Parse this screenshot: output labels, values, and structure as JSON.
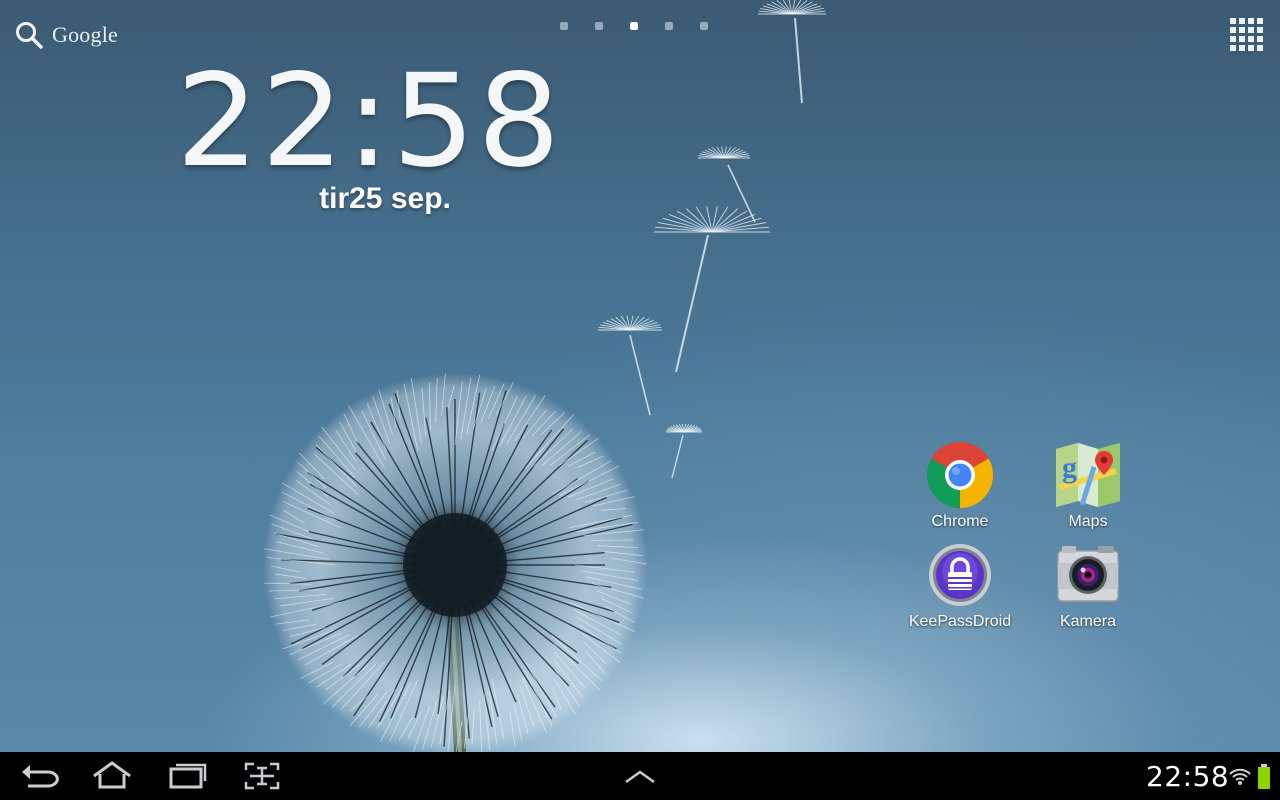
{
  "home": {
    "search_label": "Google",
    "page_count": 5,
    "active_page": 3
  },
  "clock_widget": {
    "time": "22:58",
    "date": "tir25 sep."
  },
  "apps": [
    {
      "label": "Chrome",
      "icon": "chrome-icon"
    },
    {
      "label": "Maps",
      "icon": "maps-icon"
    },
    {
      "label": "KeePassDroid",
      "icon": "keepassdroid-icon"
    },
    {
      "label": "Kamera",
      "icon": "camera-icon"
    }
  ],
  "system_bar": {
    "clock": "22:58",
    "buttons": [
      "back-icon",
      "home-icon",
      "recent-apps-icon",
      "screenshot-icon",
      "chevron-up-icon"
    ],
    "status_icons": [
      "wifi-icon",
      "battery-icon"
    ],
    "battery_color": "#8bd400"
  },
  "colors": {
    "wallpaper_top": "#3b5a73",
    "wallpaper_bottom": "#5a88a8",
    "bar": "#000000"
  }
}
